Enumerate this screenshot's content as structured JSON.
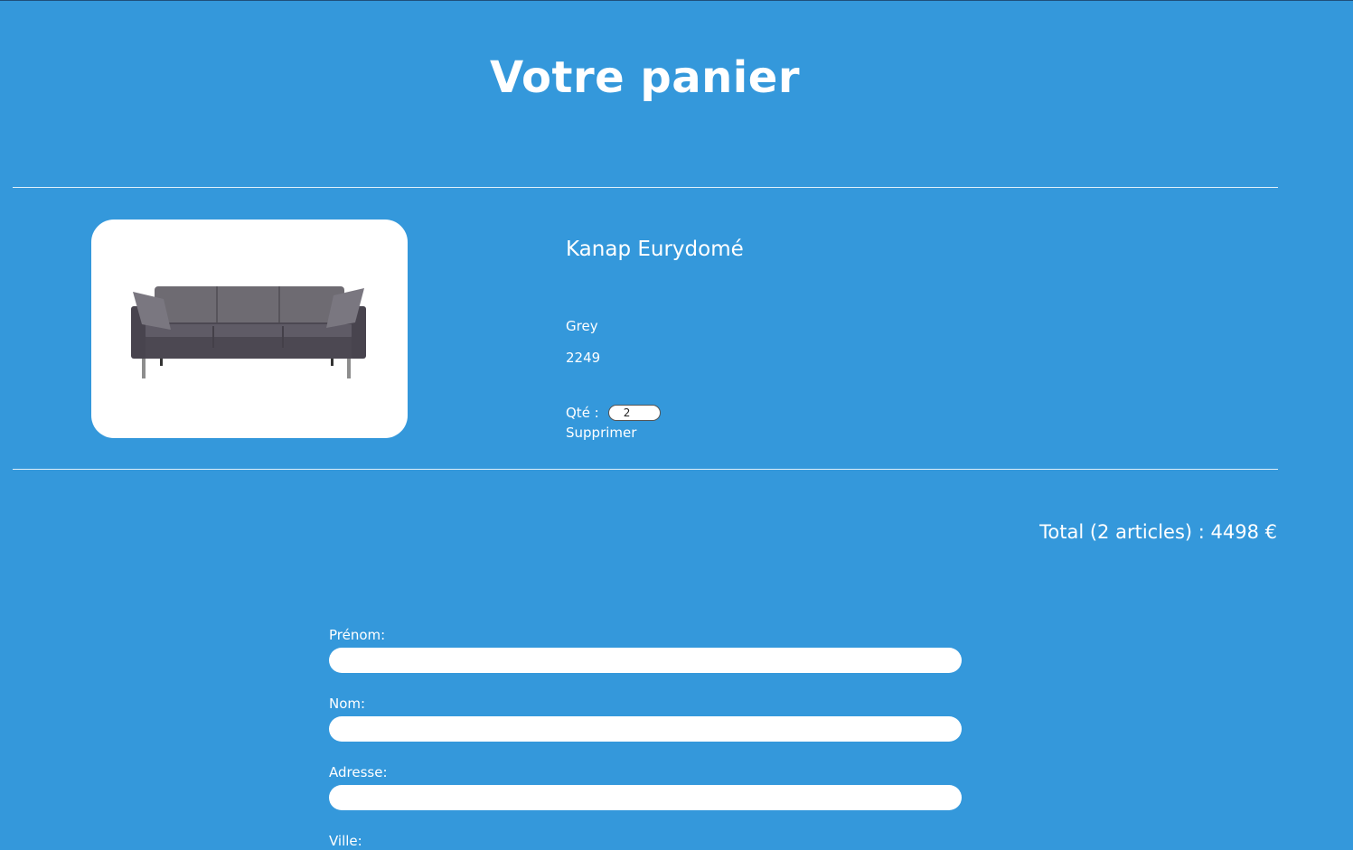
{
  "page": {
    "title": "Votre panier"
  },
  "cart": {
    "item": {
      "name": "Kanap Eurydomé",
      "color": "Grey",
      "price": "2249",
      "qty_label": "Qté :",
      "qty_value": "2",
      "delete_label": "Supprimer",
      "image_icon": "sofa-image"
    },
    "total_text": "Total (2 articles) : 4498 €"
  },
  "form": {
    "first_name_label": "Prénom:",
    "last_name_label": "Nom:",
    "address_label": "Adresse:",
    "city_label": "Ville:"
  },
  "colors": {
    "background": "#3498db",
    "text": "#ffffff",
    "card": "#ffffff",
    "sofa": "#5a5660"
  }
}
